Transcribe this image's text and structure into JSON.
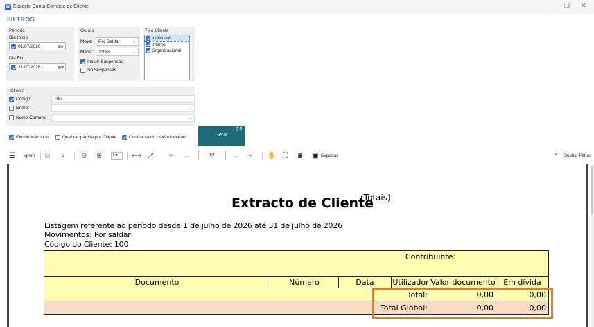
{
  "window": {
    "title": "Extracto Conta Corrente de Cliente",
    "icon_letter": "W",
    "controls": [
      "—",
      "❐",
      "✕"
    ]
  },
  "filters": {
    "heading": "FILTROS",
    "periodo": {
      "label": "Período",
      "inicio_label": "Dia Início",
      "inicio_value": "01/07/2026",
      "fim_label": "Dia Fim",
      "fim_value": "31/07/2026"
    },
    "outros": {
      "label": "Outros",
      "movs_label": "Movs:",
      "movs_value": "Por Saldar",
      "mapa_label": "Mapa:",
      "mapa_value": "Totais",
      "incluir_suspensas": "Incluir Suspensas",
      "so_suspensas": "Só Suspensas"
    },
    "tipo_cliente": {
      "label": "Tipo Cliente",
      "items": [
        "Individual",
        "Interno",
        "Organizacional"
      ]
    },
    "cliente": {
      "label": "Cliente",
      "codigo_label": "Código:",
      "codigo_value": "100",
      "nome_label": "Nome:",
      "nome_comum_label": "Nome Comum:"
    },
    "options": {
      "excluir_inactivos": "Excluir Inactivos",
      "quebrar_pagina": "Quebrar página por Cliente",
      "ocultar_saldo": "Ocultar saldo credor/devedor"
    },
    "gerar": {
      "label": "Gerar",
      "shortcut": "[F4]"
    }
  },
  "toolbar": {
    "print_label": "»prim",
    "zoom_value": "I",
    "page_value": "1/1",
    "export_label": "Exportar",
    "hide_filters_label": "Ocultar Filtros"
  },
  "report": {
    "title": "Extracto de Cliente",
    "title_suffix": "(Totais)",
    "line1": "Listagem referente ao período desde 1 de julho de 2026 até 31 de julho de 2026",
    "line2": "Movimentos: Por saldar",
    "line3": "Código do Cliente: 100",
    "contribuinte_label": "Contribuinte:",
    "columns": [
      "Documento",
      "Número",
      "Data",
      "Utilizador",
      "Valor documento",
      "Em dívida"
    ],
    "total_label": "Total:",
    "total_valor": "0,00",
    "total_divida": "0,00",
    "global_label": "Total Global:",
    "global_valor": "0,00",
    "global_divida": "0,00"
  },
  "colors": {
    "accent": "#3a7fd5",
    "gerar": "#1c6c78",
    "table_yellow": "#fefcae",
    "table_peach": "#fadcc4",
    "highlight": "#e07b29"
  }
}
